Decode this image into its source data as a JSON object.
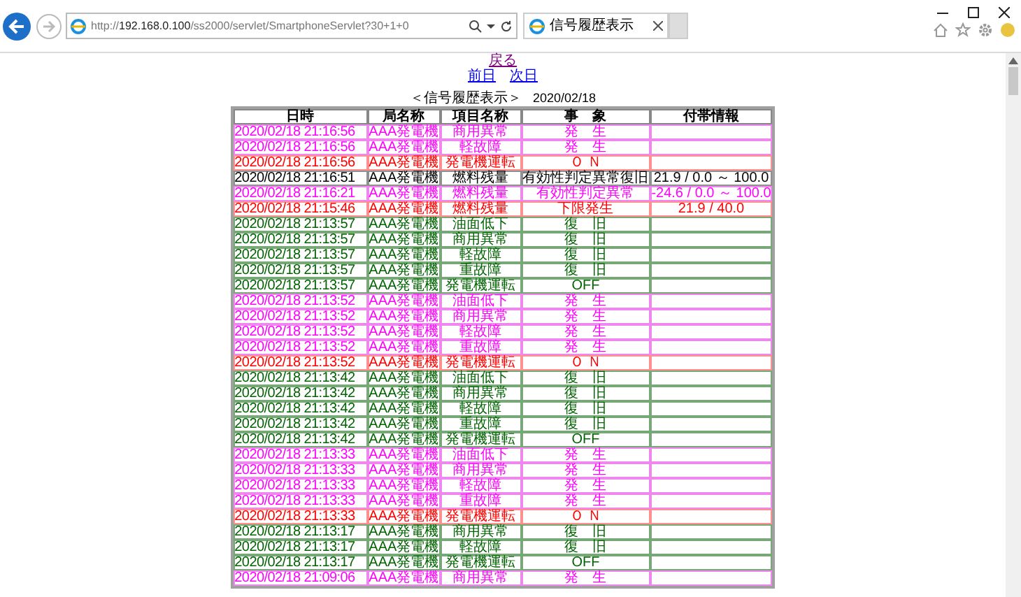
{
  "browser": {
    "url_prefix": "http://",
    "url_host": "192.168.0.100",
    "url_path": "/ss2000/servlet/SmartphoneServlet?30+1+0",
    "tab": {
      "title": "信号履歴表示",
      "selected": true
    }
  },
  "nav": {
    "back": "戻る",
    "prev": "前日",
    "next": "次日"
  },
  "caption": "＜信号履歴表示＞",
  "date": "2020/02/18",
  "table": {
    "columns": [
      "日時",
      "局名称",
      "項目名称",
      "事　象",
      "付帯情報"
    ],
    "rows": [
      {
        "kind": "occurred",
        "cells": [
          "2020/02/18 21:16:56",
          "AAA発電機",
          "商用異常",
          "発　生",
          ""
        ]
      },
      {
        "kind": "occurred",
        "cells": [
          "2020/02/18 21:16:56",
          "AAA発電機",
          "軽故障",
          "発　生",
          ""
        ]
      },
      {
        "kind": "on",
        "cells": [
          "2020/02/18 21:16:56",
          "AAA発電機",
          "発電機運転",
          "Ｏ Ｎ",
          ""
        ]
      },
      {
        "kind": "normal",
        "cells": [
          "2020/02/18 21:16:51",
          "AAA発電機",
          "燃料残量",
          "有効性判定異常復旧",
          "21.9 / 0.0 ～ 100.0"
        ]
      },
      {
        "kind": "occurred",
        "cells": [
          "2020/02/18 21:16:21",
          "AAA発電機",
          "燃料残量",
          "有効性判定異常",
          "-24.6 / 0.0 ～ 100.0"
        ]
      },
      {
        "kind": "on",
        "cells": [
          "2020/02/18 21:15:46",
          "AAA発電機",
          "燃料残量",
          "下限発生",
          "21.9 / 40.0"
        ]
      },
      {
        "kind": "restored",
        "cells": [
          "2020/02/18 21:13:57",
          "AAA発電機",
          "油面低下",
          "復　旧",
          ""
        ]
      },
      {
        "kind": "restored",
        "cells": [
          "2020/02/18 21:13:57",
          "AAA発電機",
          "商用異常",
          "復　旧",
          ""
        ]
      },
      {
        "kind": "restored",
        "cells": [
          "2020/02/18 21:13:57",
          "AAA発電機",
          "軽故障",
          "復　旧",
          ""
        ]
      },
      {
        "kind": "restored",
        "cells": [
          "2020/02/18 21:13:57",
          "AAA発電機",
          "重故障",
          "復　旧",
          ""
        ]
      },
      {
        "kind": "restored",
        "cells": [
          "2020/02/18 21:13:57",
          "AAA発電機",
          "発電機運転",
          "OFF",
          ""
        ]
      },
      {
        "kind": "occurred",
        "cells": [
          "2020/02/18 21:13:52",
          "AAA発電機",
          "油面低下",
          "発　生",
          ""
        ]
      },
      {
        "kind": "occurred",
        "cells": [
          "2020/02/18 21:13:52",
          "AAA発電機",
          "商用異常",
          "発　生",
          ""
        ]
      },
      {
        "kind": "occurred",
        "cells": [
          "2020/02/18 21:13:52",
          "AAA発電機",
          "軽故障",
          "発　生",
          ""
        ]
      },
      {
        "kind": "occurred",
        "cells": [
          "2020/02/18 21:13:52",
          "AAA発電機",
          "重故障",
          "発　生",
          ""
        ]
      },
      {
        "kind": "on",
        "cells": [
          "2020/02/18 21:13:52",
          "AAA発電機",
          "発電機運転",
          "Ｏ Ｎ",
          ""
        ]
      },
      {
        "kind": "restored",
        "cells": [
          "2020/02/18 21:13:42",
          "AAA発電機",
          "油面低下",
          "復　旧",
          ""
        ]
      },
      {
        "kind": "restored",
        "cells": [
          "2020/02/18 21:13:42",
          "AAA発電機",
          "商用異常",
          "復　旧",
          ""
        ]
      },
      {
        "kind": "restored",
        "cells": [
          "2020/02/18 21:13:42",
          "AAA発電機",
          "軽故障",
          "復　旧",
          ""
        ]
      },
      {
        "kind": "restored",
        "cells": [
          "2020/02/18 21:13:42",
          "AAA発電機",
          "重故障",
          "復　旧",
          ""
        ]
      },
      {
        "kind": "restored",
        "cells": [
          "2020/02/18 21:13:42",
          "AAA発電機",
          "発電機運転",
          "OFF",
          ""
        ]
      },
      {
        "kind": "occurred",
        "cells": [
          "2020/02/18 21:13:33",
          "AAA発電機",
          "油面低下",
          "発　生",
          ""
        ]
      },
      {
        "kind": "occurred",
        "cells": [
          "2020/02/18 21:13:33",
          "AAA発電機",
          "商用異常",
          "発　生",
          ""
        ]
      },
      {
        "kind": "occurred",
        "cells": [
          "2020/02/18 21:13:33",
          "AAA発電機",
          "軽故障",
          "発　生",
          ""
        ]
      },
      {
        "kind": "occurred",
        "cells": [
          "2020/02/18 21:13:33",
          "AAA発電機",
          "重故障",
          "発　生",
          ""
        ]
      },
      {
        "kind": "on",
        "cells": [
          "2020/02/18 21:13:33",
          "AAA発電機",
          "発電機運転",
          "Ｏ Ｎ",
          ""
        ]
      },
      {
        "kind": "restored",
        "cells": [
          "2020/02/18 21:13:17",
          "AAA発電機",
          "商用異常",
          "復　旧",
          ""
        ]
      },
      {
        "kind": "restored",
        "cells": [
          "2020/02/18 21:13:17",
          "AAA発電機",
          "軽故障",
          "復　旧",
          ""
        ]
      },
      {
        "kind": "restored",
        "cells": [
          "2020/02/18 21:13:17",
          "AAA発電機",
          "発電機運転",
          "OFF",
          ""
        ]
      },
      {
        "kind": "occurred",
        "cells": [
          "2020/02/18 21:09:06",
          "AAA発電機",
          "商用異常",
          "発　生",
          ""
        ]
      }
    ]
  }
}
